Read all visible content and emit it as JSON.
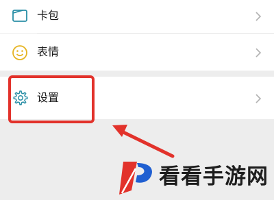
{
  "menu": {
    "items": [
      {
        "label": "卡包",
        "icon": "card-wallet-icon"
      },
      {
        "label": "表情",
        "icon": "smiley-face-icon"
      },
      {
        "label": "设置",
        "icon": "gear-icon"
      }
    ]
  },
  "annotation": {
    "highlight_color": "#e2322b",
    "arrow_color": "#e2322b",
    "icon_color": "#1aad73"
  },
  "watermark": {
    "text": "看看手游网"
  }
}
